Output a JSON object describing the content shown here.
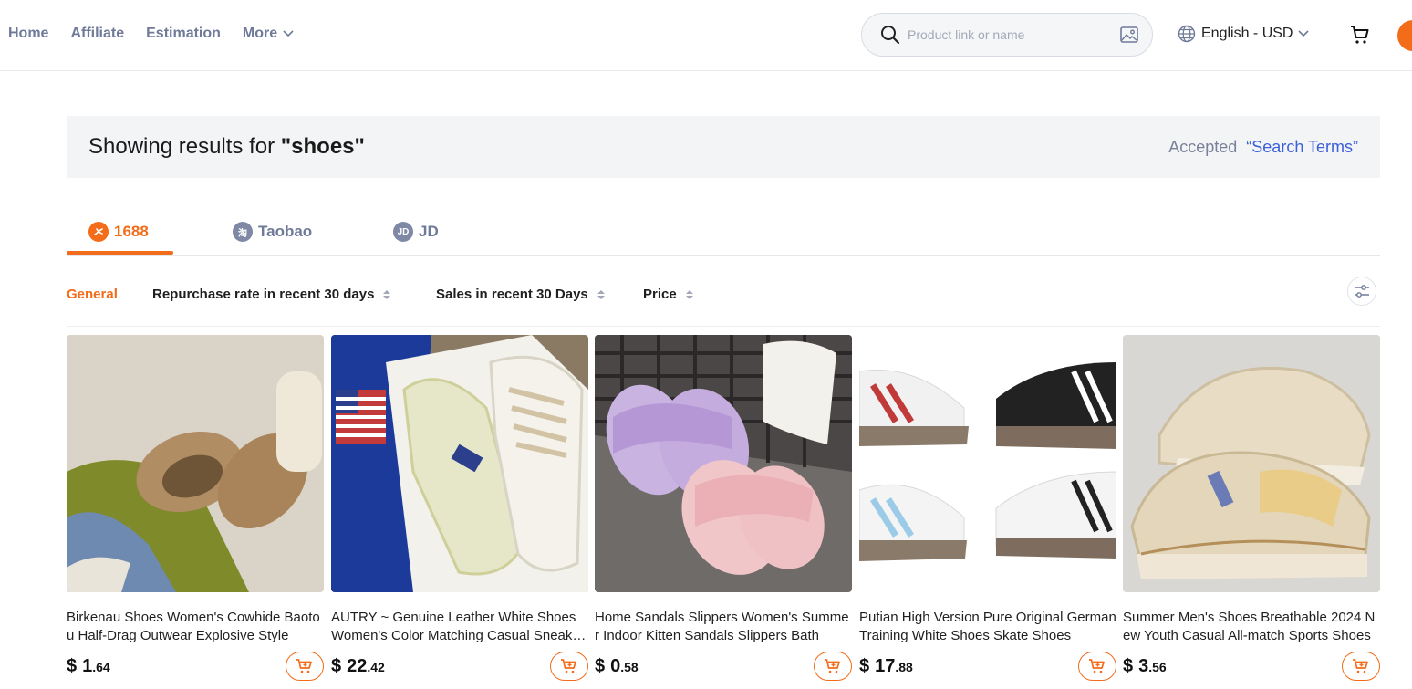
{
  "nav": {
    "home": "Home",
    "affiliate": "Affiliate",
    "estimation": "Estimation",
    "more": "More"
  },
  "search": {
    "placeholder": "Product link or name"
  },
  "lang": {
    "label": "English - USD"
  },
  "banner": {
    "prefix": "Showing results for ",
    "query": "\"shoes\"",
    "accepted": "Accepted",
    "terms_link": "“Search Terms”"
  },
  "tabs": [
    {
      "label": "1688",
      "icon": "1688-icon",
      "active": true
    },
    {
      "label": "Taobao",
      "icon": "taobao-icon",
      "badge": "淘"
    },
    {
      "label": "JD",
      "icon": "jd-icon",
      "badge": "JD"
    }
  ],
  "sort": {
    "general": "General",
    "repurchase": "Repurchase rate in recent 30 days",
    "sales": "Sales in recent 30 Days",
    "price": "Price"
  },
  "colors": {
    "accent": "#f26c1a",
    "nav": "#6f7a99",
    "link": "#3b5fd9"
  },
  "products": [
    {
      "title": "Birkenau Shoes Women's Cowhide Baotou Half-Drag Outwear Explosive Style",
      "currency": "$",
      "price_int": "1",
      "price_dec": ".64"
    },
    {
      "title": "AUTRY ~ Genuine Leather White Shoes Women's Color Matching Casual Sneakers",
      "currency": "$",
      "price_int": "22",
      "price_dec": ".42"
    },
    {
      "title": "Home Sandals Slippers Women's Summer Indoor Kitten Sandals Slippers Bath",
      "currency": "$",
      "price_int": "0",
      "price_dec": ".58"
    },
    {
      "title": "Putian High Version Pure Original German Training White Shoes Skate Shoes",
      "currency": "$",
      "price_int": "17",
      "price_dec": ".88"
    },
    {
      "title": "Summer Men's Shoes Breathable 2024 New Youth Casual All-match Sports Shoes",
      "currency": "$",
      "price_int": "3",
      "price_dec": ".56"
    }
  ]
}
